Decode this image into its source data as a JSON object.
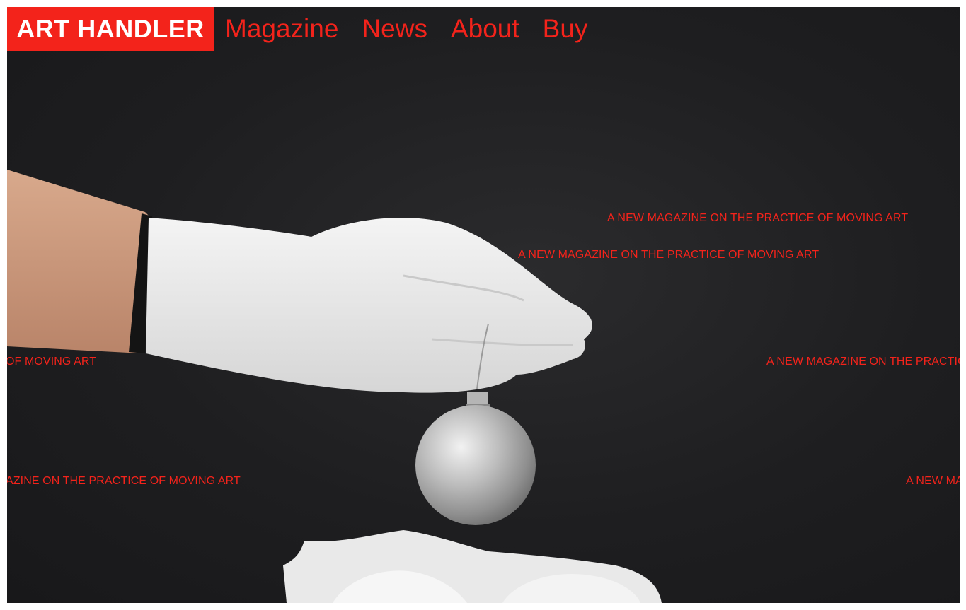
{
  "brand": {
    "logo_text": "ART HANDLER",
    "accent_color": "#f3231b"
  },
  "nav": {
    "items": [
      {
        "label": "Magazine"
      },
      {
        "label": "News"
      },
      {
        "label": "About"
      },
      {
        "label": "Buy"
      }
    ]
  },
  "taglines": {
    "line1": "A NEW MAGAZINE ON THE PRACTICE OF MOVING ART",
    "line2": "A NEW MAGAZINE ON THE PRACTICE OF MOVING ART",
    "line3_left": "OF MOVING ART",
    "line3_right": "A NEW MAGAZINE ON THE PRACTIC",
    "line4_left": "AZINE ON THE PRACTICE OF MOVING ART",
    "line4_right": "A NEW MA"
  },
  "hero": {
    "image": "gloved-hand-holding-ornament"
  }
}
